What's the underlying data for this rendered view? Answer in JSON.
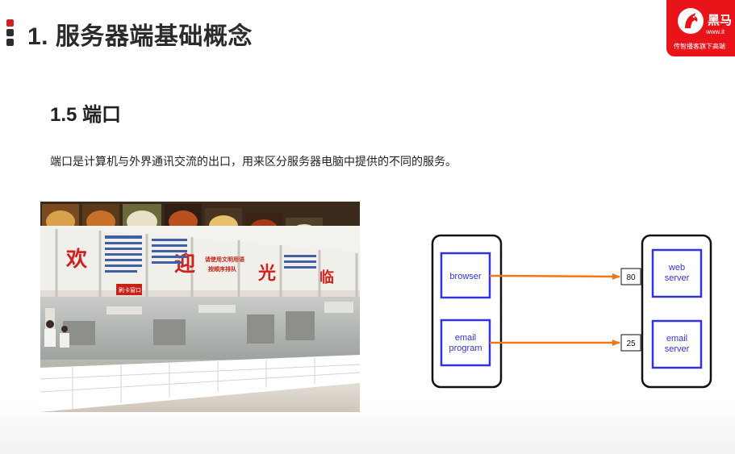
{
  "header": {
    "title": "1. 服务器端基础概念",
    "logo": {
      "brand": "黑马",
      "url": "www.it",
      "slogan": "传智播客旗下高端",
      "icon": "horse-logo-icon",
      "color": "#e8141a"
    }
  },
  "section": {
    "title": "1.5 端口",
    "description": "端口是计算机与外界通讯交流的出口，用来区分服务器电脑中提供的不同的服务。"
  },
  "photo": {
    "signs": [
      "欢",
      "迎",
      "光",
      "临"
    ],
    "banner": "请使用文明用语 按顺序排队",
    "small_notice": "刷卡窗口"
  },
  "diagram": {
    "client_apps": [
      "browser",
      "email\nprogram"
    ],
    "server_apps": [
      "web\nserver",
      "email\nserver"
    ],
    "ports": [
      "80",
      "25"
    ],
    "colors": {
      "box": "#3333dd",
      "arrow": "#f07818",
      "outline": "#111111"
    }
  }
}
